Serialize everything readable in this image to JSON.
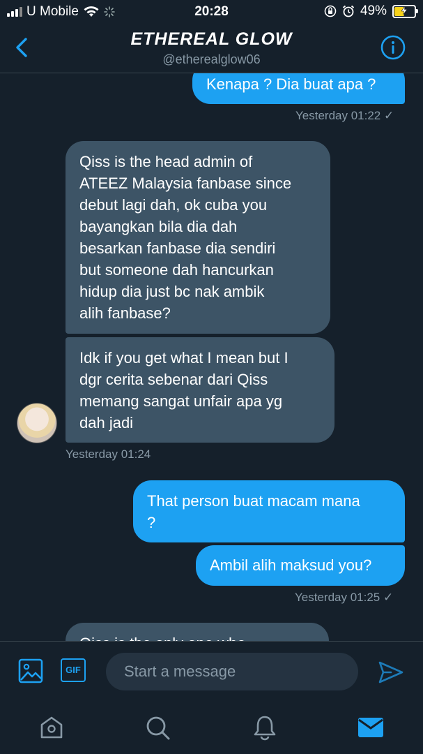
{
  "status_bar": {
    "carrier": "U Mobile",
    "time": "20:28",
    "battery_percent": "49%",
    "battery_level": 0.49,
    "icons": [
      "signal-icon",
      "wifi-icon",
      "loading-icon",
      "orientation-lock-icon",
      "alarm-icon",
      "battery-charging-icon"
    ]
  },
  "header": {
    "title": "ETHEREAL GLOW",
    "handle": "@etherealglow06",
    "back_icon": "chevron-left-icon",
    "info_icon": "info-icon"
  },
  "messages": [
    {
      "direction": "outgoing",
      "lines": [
        "Kenapa ? Dia buat apa ?"
      ]
    },
    {
      "timestamp": "Yesterday 01:22 ✓"
    },
    {
      "direction": "incoming",
      "lines": [
        "Qiss is the head admin of",
        "ATEEZ Malaysia fanbase since",
        "debut lagi dah, ok cuba you",
        "bayangkan bila dia dah",
        "besarkan fanbase dia sendiri",
        "but someone dah hancurkan",
        "hidup dia just bc nak ambik",
        "alih fanbase?"
      ]
    },
    {
      "direction": "incoming",
      "lines": [
        "Idk if you get what I mean but I",
        "dgr cerita sebenar dari Qiss",
        "memang sangat unfair apa yg",
        "dah jadi"
      ]
    },
    {
      "timestamp": "Yesterday 01:24"
    },
    {
      "direction": "outgoing",
      "lines": [
        "That person buat macam mana",
        "?"
      ]
    },
    {
      "direction": "outgoing",
      "lines": [
        "Ambil alih maksud you?"
      ]
    },
    {
      "timestamp": "Yesterday 01:25 ✓"
    },
    {
      "direction": "incoming",
      "lines": [
        "Qiss is the only one who"
      ]
    }
  ],
  "composer": {
    "placeholder": "Start a message",
    "gif_label": "GIF",
    "image_icon": "image-icon",
    "send_icon": "send-icon"
  },
  "tabbar": {
    "items": [
      "home-icon",
      "search-icon",
      "notifications-icon",
      "messages-icon"
    ],
    "active": "messages-icon"
  },
  "colors": {
    "background": "#15202b",
    "accent": "#1da1f2",
    "incoming_bubble": "#3d5466",
    "muted_text": "#8899a6"
  }
}
